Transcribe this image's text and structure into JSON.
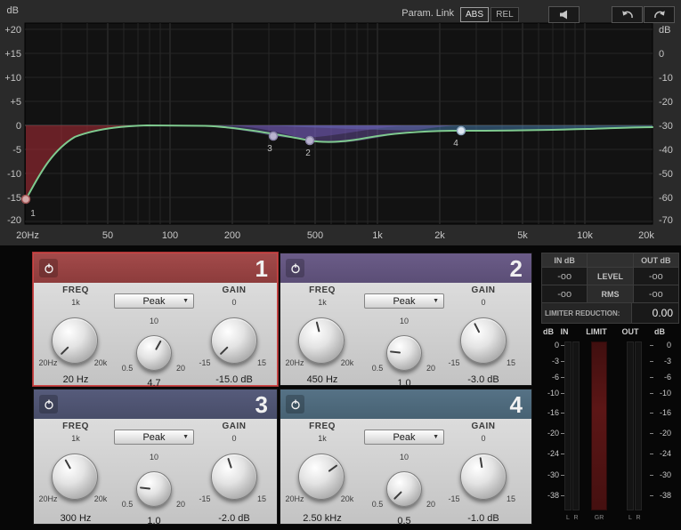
{
  "toolbar": {
    "param_link_label": "Param. Link",
    "abs_label": "ABS",
    "rel_label": "REL"
  },
  "eq": {
    "left_unit": "dB",
    "right_unit": "dB",
    "left_scale": [
      "+20",
      "+15",
      "+10",
      "+5",
      "0",
      "-5",
      "-10",
      "-15",
      "-20"
    ],
    "right_scale": [
      "0",
      "-10",
      "-20",
      "-30",
      "-40",
      "-50",
      "-60",
      "-70"
    ],
    "freq_scale": [
      "20Hz",
      "50",
      "100",
      "200",
      "500",
      "1k",
      "2k",
      "5k",
      "10k",
      "20k"
    ],
    "markers": [
      {
        "label": "1",
        "freq": "20 Hz",
        "gain_db": -15
      },
      {
        "label": "2",
        "freq": "450 Hz",
        "gain_db": -3
      },
      {
        "label": "3",
        "freq": "300 Hz",
        "gain_db": -2
      },
      {
        "label": "4",
        "freq": "2.50 kHz",
        "gain_db": -1
      }
    ]
  },
  "bands": [
    {
      "number": "1",
      "freq_label": "FREQ",
      "freq_center": "1k",
      "freq_min": "20Hz",
      "freq_max": "20k",
      "freq_value": "20 Hz",
      "filter_type": "Peak",
      "q_center": "10",
      "q_min": "0.5",
      "q_max": "20",
      "q_value": "4.7",
      "gain_label": "GAIN",
      "gain_center": "0",
      "gain_min": "-15",
      "gain_max": "15",
      "gain_value": "-15.0 dB"
    },
    {
      "number": "2",
      "freq_label": "FREQ",
      "freq_center": "1k",
      "freq_min": "20Hz",
      "freq_max": "20k",
      "freq_value": "450 Hz",
      "filter_type": "Peak",
      "q_center": "10",
      "q_min": "0.5",
      "q_max": "20",
      "q_value": "1.0",
      "gain_label": "GAIN",
      "gain_center": "0",
      "gain_min": "-15",
      "gain_max": "15",
      "gain_value": "-3.0 dB"
    },
    {
      "number": "3",
      "freq_label": "FREQ",
      "freq_center": "1k",
      "freq_min": "20Hz",
      "freq_max": "20k",
      "freq_value": "300 Hz",
      "filter_type": "Peak",
      "q_center": "10",
      "q_min": "0.5",
      "q_max": "20",
      "q_value": "1.0",
      "gain_label": "GAIN",
      "gain_center": "0",
      "gain_min": "-15",
      "gain_max": "15",
      "gain_value": "-2.0 dB"
    },
    {
      "number": "4",
      "freq_label": "FREQ",
      "freq_center": "1k",
      "freq_min": "20Hz",
      "freq_max": "20k",
      "freq_value": "2.50 kHz",
      "filter_type": "Peak",
      "q_center": "10",
      "q_min": "0.5",
      "q_max": "20",
      "q_value": "0.5",
      "gain_label": "GAIN",
      "gain_center": "0",
      "gain_min": "-15",
      "gain_max": "15",
      "gain_value": "-1.0 dB"
    }
  ],
  "meters": {
    "in_header": "IN dB",
    "out_header": "OUT dB",
    "level_label": "LEVEL",
    "rms_label": "RMS",
    "level_in": "-oo",
    "level_out": "-oo",
    "rms_in": "-oo",
    "rms_out": "-oo",
    "limiter_label": "LIMITER REDUCTION:",
    "limiter_value": "0.00",
    "col_db_left": "dB",
    "col_in": "IN",
    "col_limit": "LIMIT",
    "col_out": "OUT",
    "col_db_right": "dB",
    "scale": [
      "0",
      "-3",
      "-6",
      "-10",
      "-16",
      "-20",
      "-24",
      "-30",
      "-38"
    ],
    "bottom_labels": [
      "L",
      "R",
      "GR",
      "L",
      "R"
    ]
  },
  "colors": {
    "band1": "#9c4444",
    "band2": "#645782",
    "band3": "#4f546f",
    "band4": "#4f6b7e",
    "curve": "#7fca8f",
    "band1_fill": "#96303a",
    "band2_fill": "#7a5fbe",
    "band3_fill": "#6455aa",
    "band4_fill": "#467daf",
    "selected_border": "#cc4444"
  }
}
